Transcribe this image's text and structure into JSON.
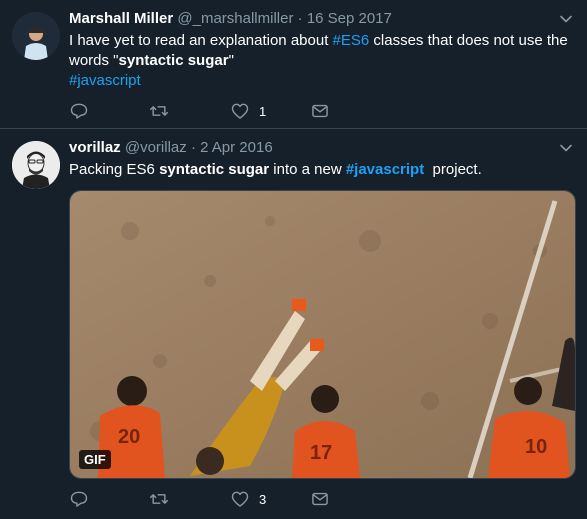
{
  "tweets": [
    {
      "name": "Marshall Miller",
      "handle": "@_marshallmiller",
      "dot": "·",
      "date": "16 Sep 2017",
      "text": {
        "p1": "I have yet to read an explanation about ",
        "link1": "#ES6",
        "p2": " classes that does not use the words \"",
        "bold1": "syntactic sugar",
        "p3": "\"",
        "tag": "#javascript"
      },
      "actions": {
        "reply": "",
        "retweet": "",
        "like": "1",
        "dm": ""
      }
    },
    {
      "name": "vorillaz",
      "handle": "@vorillaz",
      "dot": "·",
      "date": "2 Apr 2016",
      "text": {
        "p1": "Packing ES6 ",
        "bold1": "syntactic sugar",
        "p2": " into a new ",
        "link1": "#javascript",
        "p3": "  project."
      },
      "media": {
        "badge": "GIF"
      },
      "actions": {
        "reply": "",
        "retweet": "",
        "like": "3",
        "dm": ""
      }
    }
  ],
  "colors": {
    "background": "#15202b",
    "link": "#1da1f2",
    "muted": "#8899a6",
    "divider": "#38444d"
  },
  "icons": [
    "chevron-down-icon",
    "reply-icon",
    "retweet-icon",
    "like-icon",
    "dm-icon"
  ]
}
